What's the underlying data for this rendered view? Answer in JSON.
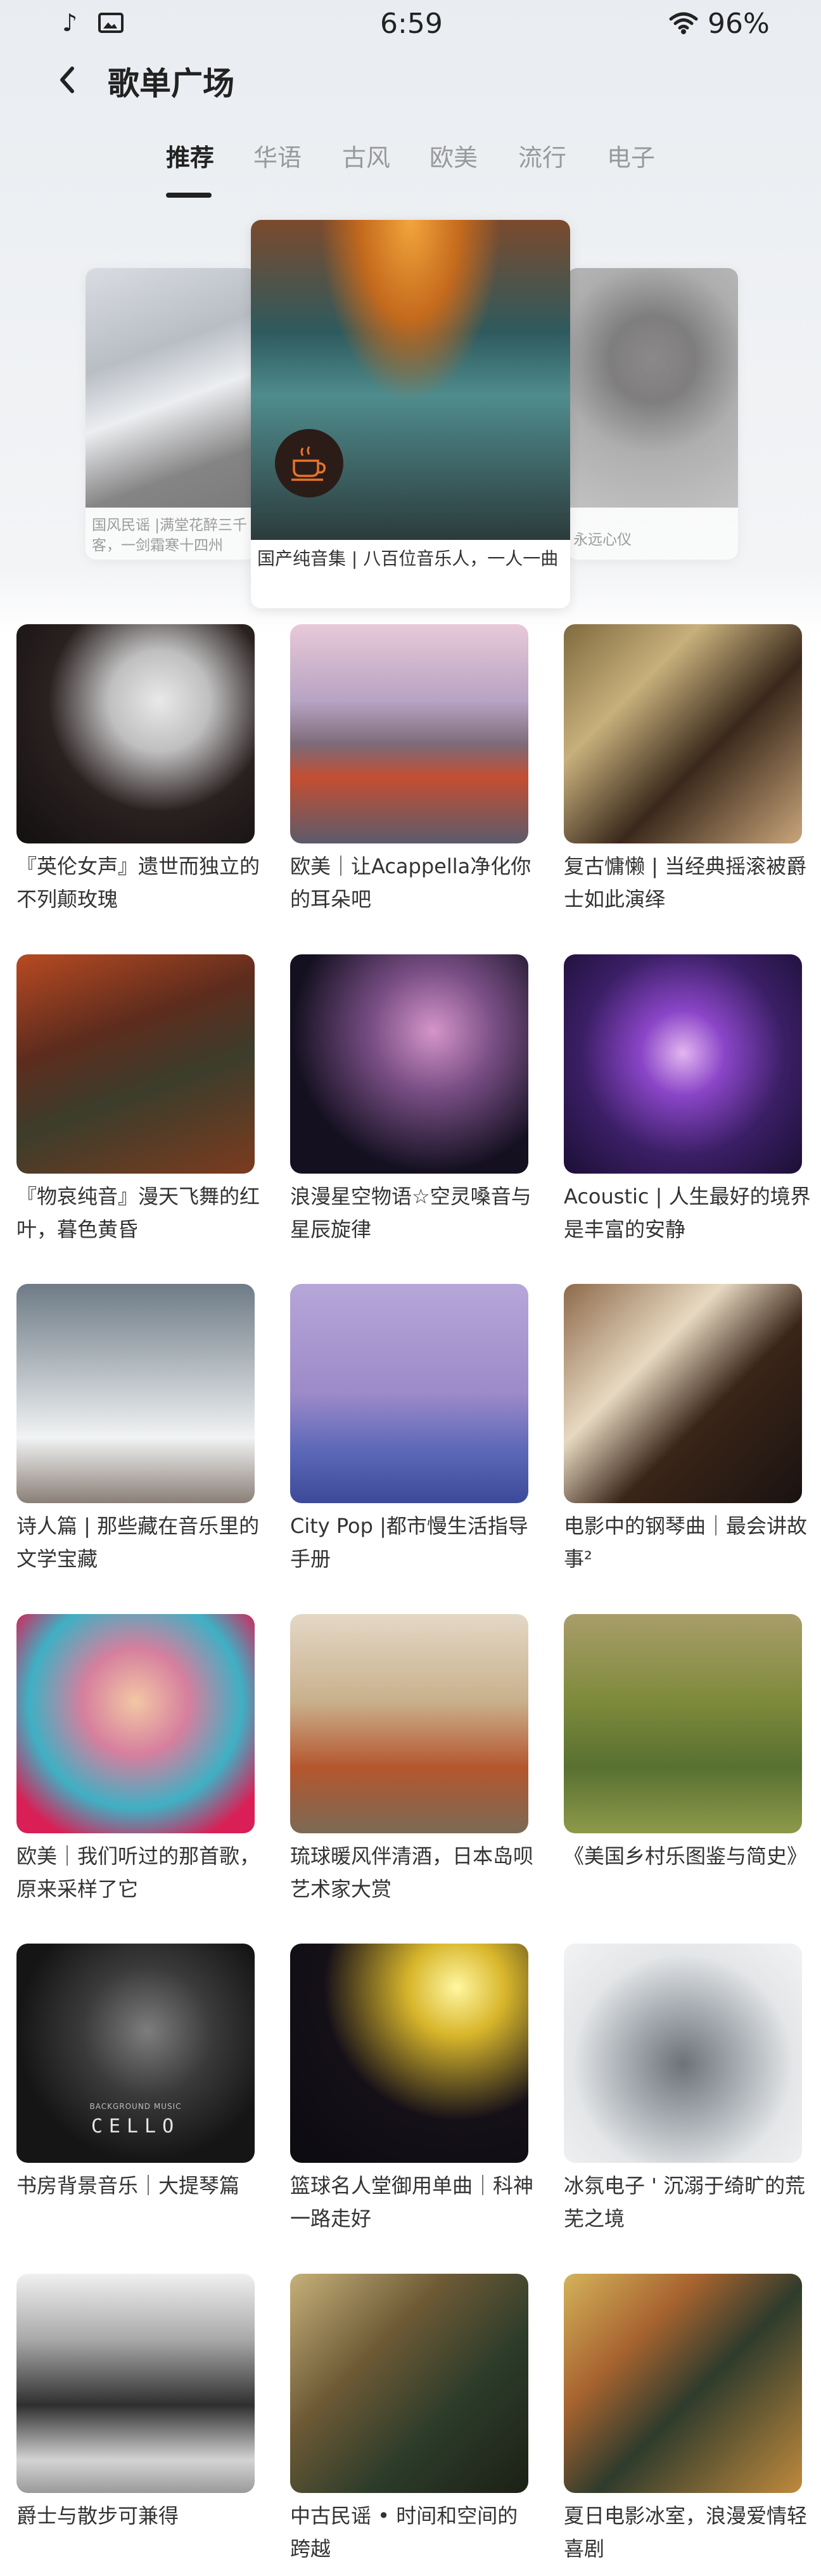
{
  "status_bar": {
    "time": "6:59",
    "battery": "96%",
    "icons": [
      "music-note-icon",
      "image-icon",
      "wifi-icon"
    ]
  },
  "header": {
    "title": "歌单广场",
    "back_icon": "chevron-left-icon"
  },
  "tabs": [
    {
      "label": "推荐",
      "active": true
    },
    {
      "label": "华语",
      "active": false
    },
    {
      "label": "古风",
      "active": false
    },
    {
      "label": "欧美",
      "active": false
    },
    {
      "label": "流行",
      "active": false
    },
    {
      "label": "电子",
      "active": false
    }
  ],
  "carousel": {
    "left": {
      "caption": "国风民谣 |满堂花醉三千客，一剑霜寒十四州"
    },
    "center": {
      "caption": "国产纯音集 | 八百位音乐人，一人一曲"
    },
    "right": {
      "caption": "永远心仪"
    }
  },
  "playlists": [
    {
      "caption": "『英伦女声』遗世而独立的不列颠玫瑰"
    },
    {
      "caption": "欧美｜让Acappella净化你的耳朵吧"
    },
    {
      "caption": "复古慵懒 | 当经典摇滚被爵士如此演绎"
    },
    {
      "caption": "『物哀纯音』漫天飞舞的红叶，暮色黄昏"
    },
    {
      "caption": "浪漫星空物语☆空灵嗓音与星辰旋律"
    },
    {
      "caption": "Acoustic | 人生最好的境界是丰富的安静"
    },
    {
      "caption": "诗人篇 | 那些藏在音乐里的文学宝藏"
    },
    {
      "caption": "City Pop |都市慢生活指导手册"
    },
    {
      "caption": "电影中的钢琴曲｜最会讲故事²"
    },
    {
      "caption": "欧美｜我们听过的那首歌，原来采样了它"
    },
    {
      "caption": "琉球暖风伴清酒，日本岛呗艺术家大赏"
    },
    {
      "caption": "《美国乡村乐图鉴与简史》"
    },
    {
      "caption": "书房背景音乐｜大提琴篇"
    },
    {
      "caption": "篮球名人堂御用单曲｜科神一路走好"
    },
    {
      "caption": "冰氛电子 ' 沉溺于绮旷的荒芜之境"
    },
    {
      "caption": "爵士与散步可兼得"
    },
    {
      "caption": "中古民谣 • 时间和空间的跨越"
    },
    {
      "caption": "夏日电影冰室，浪漫爱情轻喜剧"
    }
  ],
  "cover_texts": {
    "cello_title": "CELLO",
    "cello_sub": "BACKGROUND MUSIC"
  }
}
